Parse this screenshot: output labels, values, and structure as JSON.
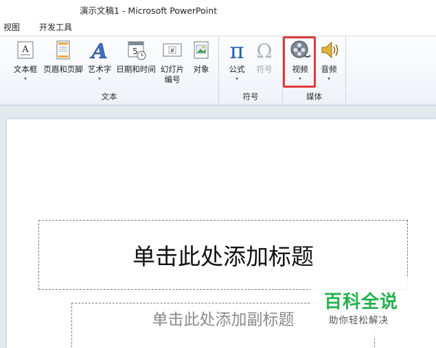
{
  "window": {
    "title": "演示文稿1 - Microsoft PowerPoint"
  },
  "menu": {
    "items": [
      "视图",
      "开发工具"
    ]
  },
  "ribbon": {
    "groups": [
      {
        "label": "文本",
        "buttons": [
          {
            "label": "文本框",
            "icon": "textbox-icon",
            "has_dropdown": true
          },
          {
            "label": "页眉和页脚",
            "icon": "header-footer-icon",
            "has_dropdown": false
          },
          {
            "label": "艺术字",
            "icon": "wordart-icon",
            "has_dropdown": true
          },
          {
            "label": "日期和时间",
            "icon": "date-time-icon",
            "has_dropdown": false
          },
          {
            "label": "幻灯片",
            "label2": "编号",
            "icon": "slide-number-icon",
            "has_dropdown": false
          },
          {
            "label": "对象",
            "icon": "object-icon",
            "has_dropdown": false
          }
        ]
      },
      {
        "label": "符号",
        "buttons": [
          {
            "label": "公式",
            "icon": "equation-icon",
            "has_dropdown": true
          },
          {
            "label": "符号",
            "icon": "symbol-icon",
            "has_dropdown": false,
            "disabled": true
          }
        ]
      },
      {
        "label": "媒体",
        "buttons": [
          {
            "label": "视频",
            "icon": "video-icon",
            "has_dropdown": true,
            "highlighted": true
          },
          {
            "label": "音频",
            "icon": "audio-icon",
            "has_dropdown": true
          }
        ]
      }
    ],
    "dropdown_glyph": "▾"
  },
  "slide": {
    "title_placeholder": "单击此处添加标题",
    "subtitle_placeholder": "单击此处添加副标题"
  },
  "watermark": {
    "main": "百科全说",
    "sub": "助你轻松解决"
  },
  "colors": {
    "highlight": "#e23a3a",
    "watermark_green": "#23b14d",
    "equation_blue": "#1f5fb4"
  }
}
